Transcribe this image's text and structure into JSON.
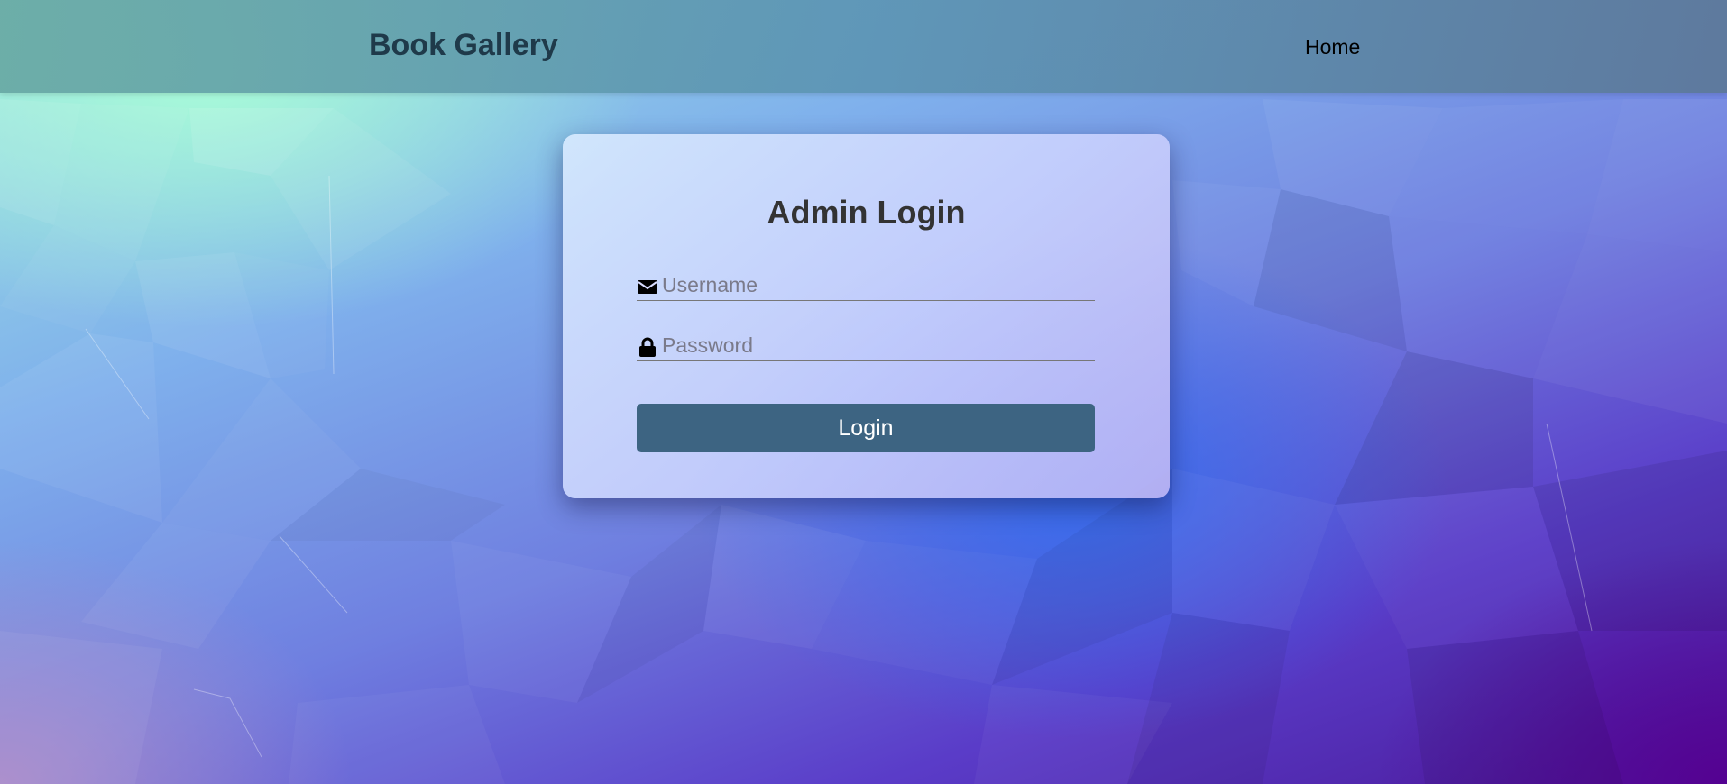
{
  "navbar": {
    "brand": "Book Gallery",
    "links": [
      {
        "label": "Home"
      }
    ]
  },
  "login": {
    "title": "Admin Login",
    "username": {
      "placeholder": "Username",
      "value": "",
      "icon": "envelope-icon"
    },
    "password": {
      "placeholder": "Password",
      "value": "",
      "icon": "lock-icon"
    },
    "submit_label": "Login"
  },
  "colors": {
    "navbar": "#5e97ad",
    "brand_text": "#1f3a4a",
    "button": "#3d6482",
    "card": "#d8dcff"
  }
}
